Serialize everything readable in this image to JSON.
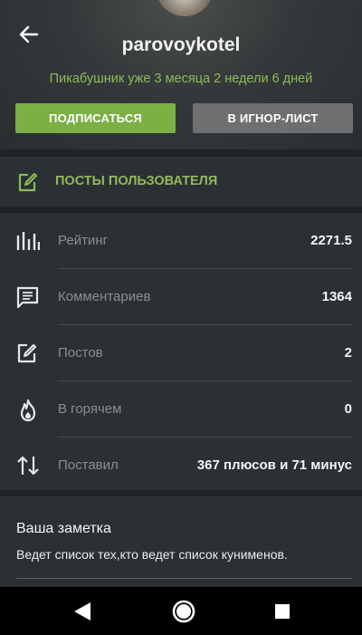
{
  "profile": {
    "username": "parovoykotel",
    "tenure": "Пикабушник уже 3 месяца 2 недели 6 дней",
    "subscribe_label": "ПОДПИСАТЬСЯ",
    "ignore_label": "В ИГНОР-ЛИСТ"
  },
  "posts_link": {
    "label": "ПОСТЫ ПОЛЬЗОВАТЕЛЯ",
    "icon": "edit-icon"
  },
  "stats": [
    {
      "label": "Рейтинг",
      "value": "2271.5",
      "icon": "bar-chart-icon"
    },
    {
      "label": "Комментариев",
      "value": "1364",
      "icon": "comment-icon"
    },
    {
      "label": "Постов",
      "value": "2",
      "icon": "edit-icon"
    },
    {
      "label": "В горячем",
      "value": "0",
      "icon": "flame-icon"
    },
    {
      "label": "Поставил",
      "value": "367 плюсов и 71 минус",
      "icon": "up-down-arrows-icon"
    }
  ],
  "note": {
    "title": "Ваша заметка",
    "text": "Ведет список тех,кто ведет список кунименов."
  },
  "colors": {
    "accent_green": "#8fba5b",
    "subscribe_bg": "#7ab044",
    "ignore_bg": "#6d6f71",
    "card_bg": "#2b3034",
    "page_bg": "#1f2326"
  }
}
